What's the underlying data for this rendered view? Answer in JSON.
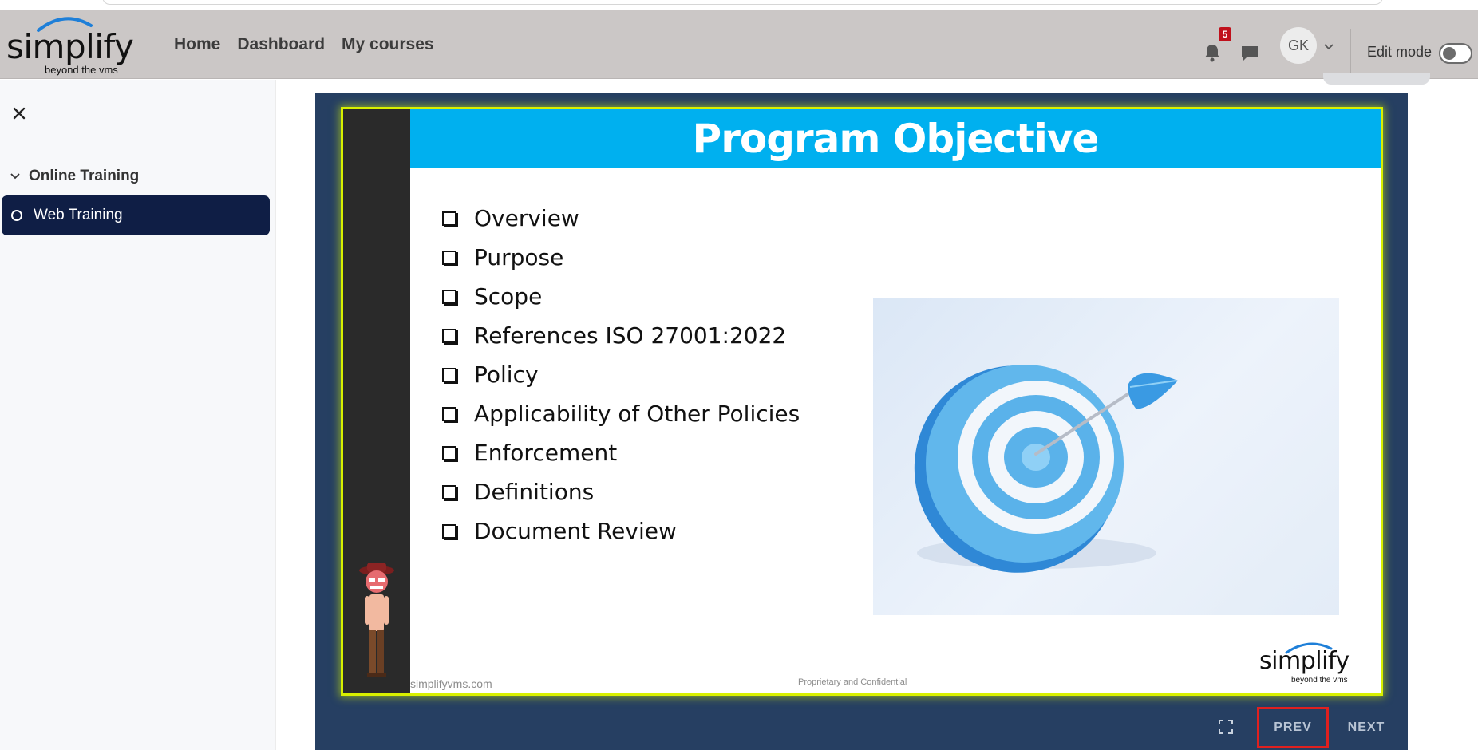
{
  "brand": {
    "logo_word": "simplify",
    "logo_tagline": "beyond the vms"
  },
  "nav": {
    "links": [
      "Home",
      "Dashboard",
      "My courses"
    ],
    "notification_count": "5",
    "avatar_initials": "GK",
    "edit_mode_label": "Edit mode"
  },
  "sidebar": {
    "section_label": "Online Training",
    "active_item": "Web Training"
  },
  "slide": {
    "title": "Program Objective",
    "bullets": [
      "Overview",
      "Purpose",
      "Scope",
      "References ISO 27001:2022",
      "Policy",
      "Applicability of Other Policies",
      "Enforcement",
      "Definitions",
      "Document Review"
    ],
    "footer_url": "simplifyvms.com",
    "footer_confidential": "Proprietary and Confidential",
    "logo_word": "simplify",
    "logo_tagline": "beyond the vms"
  },
  "player": {
    "prev_label": "PREV",
    "next_label": "NEXT"
  },
  "colors": {
    "navbar_bg": "#cbc7c6",
    "sidebar_active_bg": "#0f1e45",
    "slide_title_band": "#00b0ef",
    "player_bg": "#263f62",
    "prev_highlight": "#e0201f"
  },
  "icons": [
    "bell-icon",
    "chat-icon",
    "chevron-down-icon",
    "close-icon",
    "fullscreen-icon",
    "target-dart-icon"
  ]
}
